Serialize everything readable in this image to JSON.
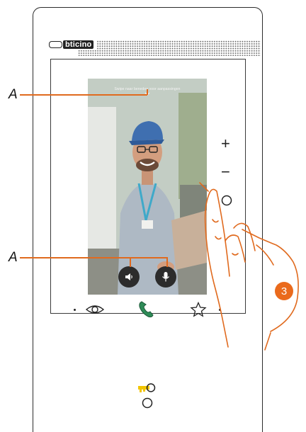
{
  "brand": {
    "name": "bticino"
  },
  "screen": {
    "hint_text": "Swipe naar beneden voor aanpassingen",
    "controls": [
      {
        "id": "speaker",
        "icon": "speaker-icon"
      },
      {
        "id": "microphone",
        "icon": "microphone-icon"
      }
    ]
  },
  "side_controls": {
    "volume_up": "+",
    "volume_down": "−",
    "circle": "○"
  },
  "annotations": {
    "top_label": "A",
    "bottom_label": "A",
    "step_number": "3"
  },
  "bottom_buttons": [
    {
      "id": "eye",
      "icon": "eye-icon"
    },
    {
      "id": "answer",
      "icon": "phone-handset-icon",
      "color": "#2e8b57"
    },
    {
      "id": "favorite",
      "icon": "star-icon"
    }
  ],
  "door_lock": {
    "icon": "key-icon",
    "color": "#f2c500"
  },
  "colors": {
    "accent": "#ea6a1c",
    "frame": "#2b2b2b"
  }
}
